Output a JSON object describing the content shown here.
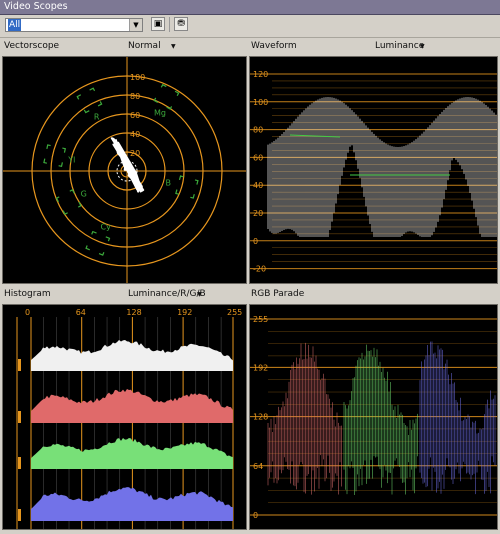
{
  "window": {
    "title": "Video Scopes"
  },
  "toolbar": {
    "source_value": "All",
    "btn1_glyph": "▣",
    "btn2_glyph": "⛃"
  },
  "vectorscope": {
    "label": "Vectorscope",
    "mode": "Normal",
    "ring_labels": [
      "20",
      "40",
      "60",
      "80",
      "100"
    ],
    "targets": [
      "R",
      "Mg",
      "B",
      "Cy",
      "G",
      "Yl"
    ],
    "trace_color": "#ffffff",
    "graticule_color": "#e6961e",
    "target_color": "#3caa3c"
  },
  "waveform": {
    "label": "Waveform",
    "mode": "Luminance",
    "scale": [
      "120",
      "100",
      "80",
      "60",
      "40",
      "20",
      "0",
      "-20"
    ],
    "trace_color": "#ffffff",
    "graticule_color": "#e6961e"
  },
  "histogram": {
    "label": "Histogram",
    "mode": "Luminance/R/G/B",
    "scale": [
      "0",
      "64",
      "128",
      "192",
      "255"
    ],
    "channel_colors": [
      "#f0f0f0",
      "#e06a6a",
      "#78e078",
      "#7272e8"
    ]
  },
  "rgb_parade": {
    "label": "RGB Parade",
    "scale": [
      "255",
      "192",
      "128",
      "64",
      "0"
    ],
    "channel_colors": [
      "#e07070",
      "#70e070",
      "#7070ea"
    ]
  }
}
